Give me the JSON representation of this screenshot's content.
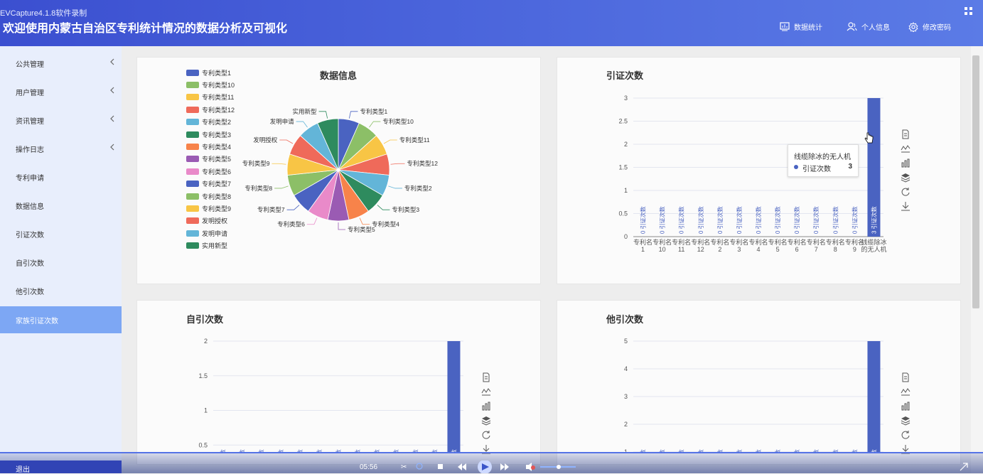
{
  "header": {
    "capture_label": "EVCapture4.1.8软件录制",
    "title": "欢迎使用内蒙古自治区专利统计情况的数据分析及可视化",
    "nav": [
      {
        "label": "数据统计",
        "icon": "chart-icon"
      },
      {
        "label": "个人信息",
        "icon": "users-icon"
      },
      {
        "label": "修改密码",
        "icon": "gear-icon"
      }
    ]
  },
  "sidebar": {
    "items": [
      {
        "label": "公共管理",
        "has_submenu": true
      },
      {
        "label": "用户管理",
        "has_submenu": true
      },
      {
        "label": "资讯管理",
        "has_submenu": true
      },
      {
        "label": "操作日志",
        "has_submenu": true
      },
      {
        "label": "专利申请",
        "has_submenu": false
      },
      {
        "label": "数据信息",
        "has_submenu": false
      },
      {
        "label": "引证次数",
        "has_submenu": false
      },
      {
        "label": "自引次数",
        "has_submenu": false
      },
      {
        "label": "他引次数",
        "has_submenu": false
      },
      {
        "label": "家族引证次数",
        "has_submenu": false,
        "active": true
      }
    ],
    "logout_label": "退出"
  },
  "colors": {
    "header_start": "#3b4fd0",
    "header_end": "#5b7be6",
    "sidebar_bg": "#e8eefc",
    "sidebar_active": "#7da7f4",
    "bar": "#4a63c1"
  },
  "panels": {
    "pie_title": "数据信息",
    "cite_title": "引证次数",
    "self_title": "自引次数",
    "other_title": "他引次数"
  },
  "tooltip": {
    "header": "线缆除冰的无人机",
    "series": "引证次数",
    "value": "3"
  },
  "player": {
    "time": "05:56"
  },
  "toolbox_icons": [
    "data-view-icon",
    "line-chart-icon",
    "bar-chart-icon",
    "stack-icon",
    "restore-icon",
    "download-icon"
  ],
  "chart_data": [
    {
      "type": "pie",
      "title": "数据信息",
      "categories": [
        "专利类型1",
        "专利类型10",
        "专利类型11",
        "专利类型12",
        "专利类型2",
        "专利类型3",
        "专利类型4",
        "专利类型5",
        "专利类型6",
        "专利类型7",
        "专利类型8",
        "专利类型9",
        "发明授权",
        "发明申请",
        "实用新型"
      ],
      "values": [
        1,
        1,
        1,
        1,
        1,
        1,
        1,
        1,
        1,
        1,
        1,
        1,
        1,
        1,
        1
      ],
      "colors": [
        "#4a63c1",
        "#8cbf67",
        "#f8c545",
        "#ef6a5a",
        "#63b5d8",
        "#2e8b5e",
        "#f7834a",
        "#9a5bb3",
        "#e98ac9",
        "#4a63c1",
        "#8cbf67",
        "#f8c545",
        "#ef6a5a",
        "#63b5d8",
        "#2e8b5e"
      ],
      "legend": "left"
    },
    {
      "type": "bar",
      "title": "引证次数",
      "series_name": "引证次数",
      "categories": [
        "专利名称1",
        "专利名称10",
        "专利名称11",
        "专利名称12",
        "专利名称2",
        "专利名称3",
        "专利名称4",
        "专利名称5",
        "专利名称6",
        "专利名称7",
        "专利名称8",
        "专利名称9",
        "线缆除冰的无人机"
      ],
      "tick_lines": [
        [
          "专利名",
          "1"
        ],
        [
          "专利名",
          "10"
        ],
        [
          "专利名",
          "11"
        ],
        [
          "专利名",
          "12"
        ],
        [
          "专利名",
          "2"
        ],
        [
          "专利名",
          "3"
        ],
        [
          "专利名",
          "4"
        ],
        [
          "专利名",
          "5"
        ],
        [
          "专利名",
          "6"
        ],
        [
          "专利名",
          "7"
        ],
        [
          "专利名",
          "8"
        ],
        [
          "专利名",
          "9"
        ],
        [
          "线缆除冰",
          "的无人机"
        ]
      ],
      "values": [
        0,
        0,
        0,
        0,
        0,
        0,
        0,
        0,
        0,
        0,
        0,
        0,
        3
      ],
      "ylim": [
        0,
        3
      ],
      "yticks": [
        0,
        0.5,
        1,
        1.5,
        2,
        2.5,
        3
      ],
      "grid": true
    },
    {
      "type": "bar",
      "title": "自引次数",
      "series_name": "自引次数",
      "values": [
        0,
        0,
        0,
        0,
        0,
        0,
        0,
        0,
        0,
        0,
        0,
        0,
        2
      ],
      "ylim": [
        0,
        2
      ],
      "yticks": [
        0.5,
        1,
        1.5,
        2
      ],
      "grid": true
    },
    {
      "type": "bar",
      "title": "他引次数",
      "series_name": "他引次数",
      "values": [
        0,
        0,
        0,
        0,
        0,
        0,
        0,
        0,
        0,
        0,
        0,
        0,
        5
      ],
      "ylim": [
        0,
        5
      ],
      "yticks": [
        1,
        2,
        3,
        4,
        5
      ],
      "grid": true
    }
  ]
}
